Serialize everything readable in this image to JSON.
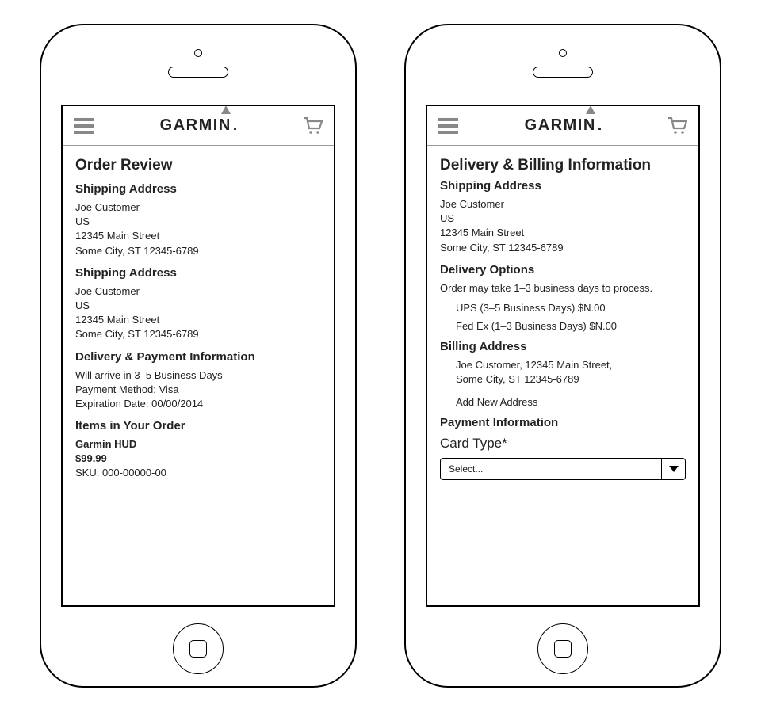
{
  "brand": "GARMIN",
  "left": {
    "title": "Order Review",
    "shipping1_heading": "Shipping Address",
    "shipping1": {
      "name": "Joe Customer",
      "country": "US",
      "street": "12345 Main Street",
      "city": "Some City, ST 12345-6789"
    },
    "shipping2_heading": "Shipping Address",
    "shipping2": {
      "name": "Joe Customer",
      "country": "US",
      "street": "12345 Main Street",
      "city": "Some City, ST 12345-6789"
    },
    "payment_heading": "Delivery & Payment Information",
    "payment": {
      "arrival": "Will arrive in 3–5 Business Days",
      "method": "Payment Method: Visa",
      "expiry": "Expiration Date: 00/00/2014"
    },
    "items_heading": "Items in Your Order",
    "item": {
      "name": "Garmin HUD",
      "price": "$99.99",
      "sku": "SKU: 000-00000-00"
    }
  },
  "right": {
    "title": "Delivery & Billing Information",
    "shipping_heading": "Shipping Address",
    "shipping": {
      "name": "Joe Customer",
      "country": "US",
      "street": "12345 Main Street",
      "city": "Some City, ST 12345-6789"
    },
    "delivery_heading": "Delivery Options",
    "delivery_note": "Order may take 1–3 business days to process.",
    "options": {
      "ups": "UPS (3–5 Business Days) $N.00",
      "fedex": "Fed Ex (1–3 Business Days) $N.00"
    },
    "billing_heading": "Billing Address",
    "billing": {
      "line1": "Joe Customer, 12345 Main Street,",
      "line2": "Some City, ST 12345-6789",
      "add_new": "Add New Address"
    },
    "payment_heading": "Payment Information",
    "card_type_label": "Card Type*",
    "select_placeholder": "Select..."
  }
}
